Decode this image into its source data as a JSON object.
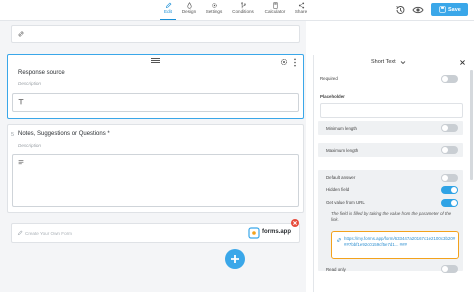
{
  "nav": {
    "items": [
      {
        "label": "Edit",
        "active": true,
        "icon": "pencil-icon"
      },
      {
        "label": "Design",
        "active": false,
        "icon": "droplet-icon"
      },
      {
        "label": "Settings",
        "active": false,
        "icon": "gear-icon"
      },
      {
        "label": "Conditions",
        "active": false,
        "icon": "branch-icon"
      },
      {
        "label": "Calculator",
        "active": false,
        "icon": "calculator-icon"
      },
      {
        "label": "Share",
        "active": false,
        "icon": "share-icon"
      }
    ],
    "save_label": "Save"
  },
  "questions": [
    {
      "number": "",
      "title": "Response source",
      "description": "Description"
    },
    {
      "number": "5",
      "title": "Notes, Suggestions or Questions *",
      "description": "Description"
    }
  ],
  "footer": {
    "create_text": "Create Your Own Form",
    "brand": "forms.app"
  },
  "panel": {
    "type_label": "Short Text",
    "required_label": "Required",
    "placeholder_label": "Placeholder",
    "min_length_label": "Minimum length",
    "max_length_label": "Maximum length",
    "default_answer_label": "Default answer",
    "hidden_field_label": "Hidden field",
    "get_value_label": "Get value from URL",
    "hint": "The field is filled by taking the value from the parameter of the link.",
    "url": "https://my.forms.app/form/633447a20167c1e2100c3b20###7bbf1e92c0159cf5e7d1... ###",
    "read_only_label": "Read only",
    "toggles": {
      "required": false,
      "min_length": false,
      "max_length": false,
      "default_answer": false,
      "hidden_field": true,
      "get_value": true,
      "read_only": false
    }
  },
  "colors": {
    "accent": "#3aa7e9",
    "highlight": "#f3a21c",
    "close": "#e74c3c"
  }
}
